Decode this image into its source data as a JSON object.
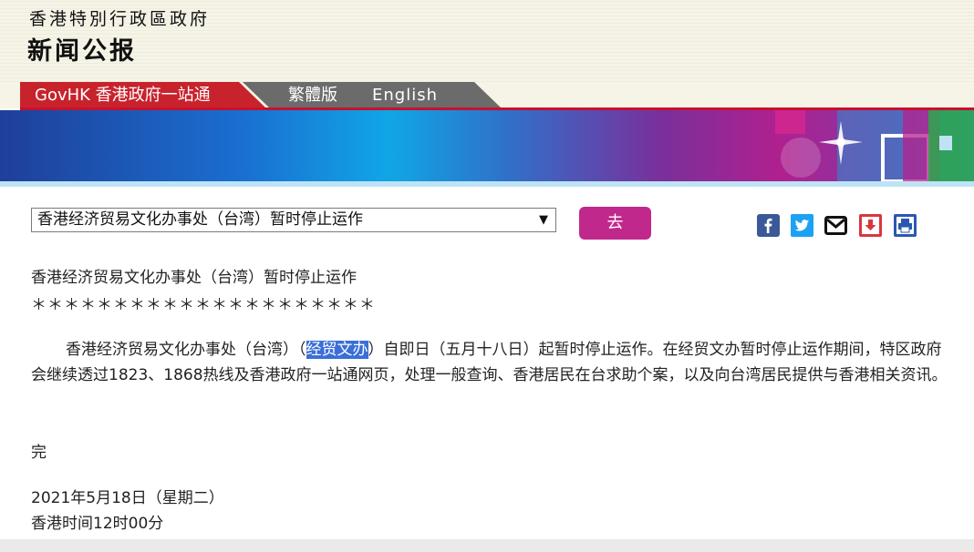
{
  "header": {
    "government_name": "香港特別行政區政府",
    "page_title": "新闻公报"
  },
  "nav": {
    "govhk_label": "GovHK 香港政府一站通",
    "traditional_label": "繁體版",
    "english_label": "English"
  },
  "selector": {
    "selected": "香港经济贸易文化办事处（台湾）暂时停止运作",
    "arrow": "▼",
    "go_label": "去"
  },
  "share_icons": [
    "facebook-icon",
    "twitter-icon",
    "email-icon",
    "download-icon",
    "print-icon"
  ],
  "colors": {
    "accent": "#c8232c",
    "go_button": "#c0288c",
    "nav_gray": "#6b6b6b",
    "highlight": "#3a6fd8"
  },
  "article": {
    "subject": "香港经济贸易文化办事处（台湾）暂时停止运作",
    "stars": "＊＊＊＊＊＊＊＊＊＊＊＊＊＊＊＊＊＊＊＊＊",
    "body_before": "香港经济贸易文化办事处（台湾）（",
    "body_highlight": "经贸文办",
    "body_after": "）自即日（五月十八日）起暂时停止运作。在经贸文办暂时停止运作期间，特区政府会继续透过1823、1868热线及香港政府一站通网页，处理一般查询、香港居民在台求助个案，以及向台湾居民提供与香港相关资讯。",
    "end": "完",
    "date": "2021年5月18日（星期二）",
    "time": "香港时间12时00分"
  }
}
